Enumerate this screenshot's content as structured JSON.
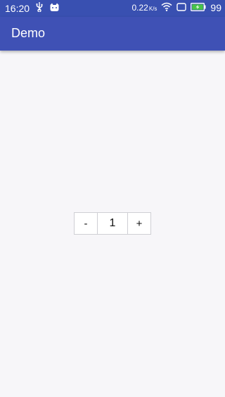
{
  "status_bar": {
    "time": "16:20",
    "net_speed_value": "0.22",
    "net_speed_unit": "K/s",
    "battery_level": "99",
    "background_color": "#3950b1",
    "icons": [
      "usb-icon",
      "cat-icon",
      "wifi-icon",
      "sim-icon",
      "battery-icon"
    ]
  },
  "app_bar": {
    "title": "Demo",
    "background_color": "#3f51b5"
  },
  "stepper": {
    "decrement_label": "-",
    "value": "1",
    "increment_label": "+"
  },
  "page": {
    "background_color": "#f7f6f9"
  }
}
